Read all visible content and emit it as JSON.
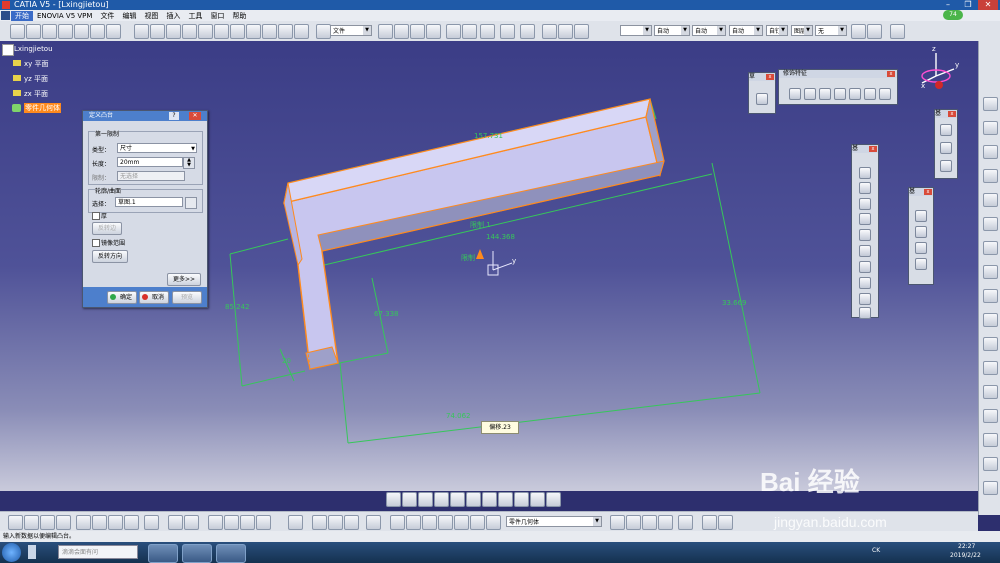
{
  "window": {
    "title": "CATIA V5 - [Lxingjietou]",
    "controls": [
      "–",
      "❐",
      "✕"
    ]
  },
  "menu": [
    "开始",
    "ENOVIA V5 VPM",
    "文件",
    "编辑",
    "视图",
    "插入",
    "工具",
    "窗口",
    "帮助"
  ],
  "toolbar": {
    "combo_file": "文件",
    "combo_auto1": "自动",
    "combo_auto2": "自动",
    "combo_auto3": "自动",
    "combo_auto4": "自动",
    "combo_none": "无",
    "combo_blank_b": "自钉",
    "combo_blank_c": "图层"
  },
  "tree": {
    "root": "Lxingjietou",
    "items": [
      "xy 平面",
      "yz 平面",
      "zx 平面"
    ],
    "selected": "零件几何体"
  },
  "dialog": {
    "title": "定义凸台",
    "help": "?",
    "close": "✕",
    "group_first_limit": "第一限制",
    "type_label": "类型：",
    "type_value": "尺寸",
    "length_label": "长度：",
    "length_value": "20mm",
    "limit_label": "限制：",
    "limit_value": "无选择",
    "group_profile": "轮廓/曲面",
    "select_label": "选择：",
    "select_value": "草图.1",
    "thick_label": "厚",
    "reverse_side": "反转边",
    "mirror_label": "镜像范围",
    "reverse_dir": "反转方向",
    "more": "更多>>",
    "ok": "确定",
    "cancel": "取消",
    "preview": "预览"
  },
  "palettes": {
    "sketch_title": "草",
    "feature_title": "修饰特征",
    "vertical1_title": "基",
    "vertical2_title": "基",
    "vertical3_title": "基"
  },
  "annotations": {
    "dim_157": "157.731",
    "dim_144": "144.368",
    "dim_85": "85.242",
    "dim_67": "67.338",
    "dim_20": "20",
    "dim_33": "33.669",
    "dim_bottom": "74.062",
    "limit1": "限制 1",
    "limit": "限制",
    "axis_y": "y",
    "tooltip": "偏移.23"
  },
  "compass": {
    "x": "x",
    "y": "y",
    "z": "z"
  },
  "badge": "74",
  "body_combo": "零件几何体",
  "status": {
    "message": "输入新数据以便编辑凸台。"
  },
  "taskbar": {
    "search_placeholder": "滴滴会面有问",
    "time": "22:27",
    "date": "2019/2/22",
    "ime": "CK"
  },
  "watermark": {
    "brand": "Bai 经验",
    "url": "jingyan.baidu.com"
  },
  "colors": {
    "accent_orange": "#ff8a1e",
    "part_fill": "#c8c6ef",
    "dimension_green": "#36c75a",
    "dialog_header": "#4d7fcc",
    "title_bar": "#1f5aa8"
  }
}
